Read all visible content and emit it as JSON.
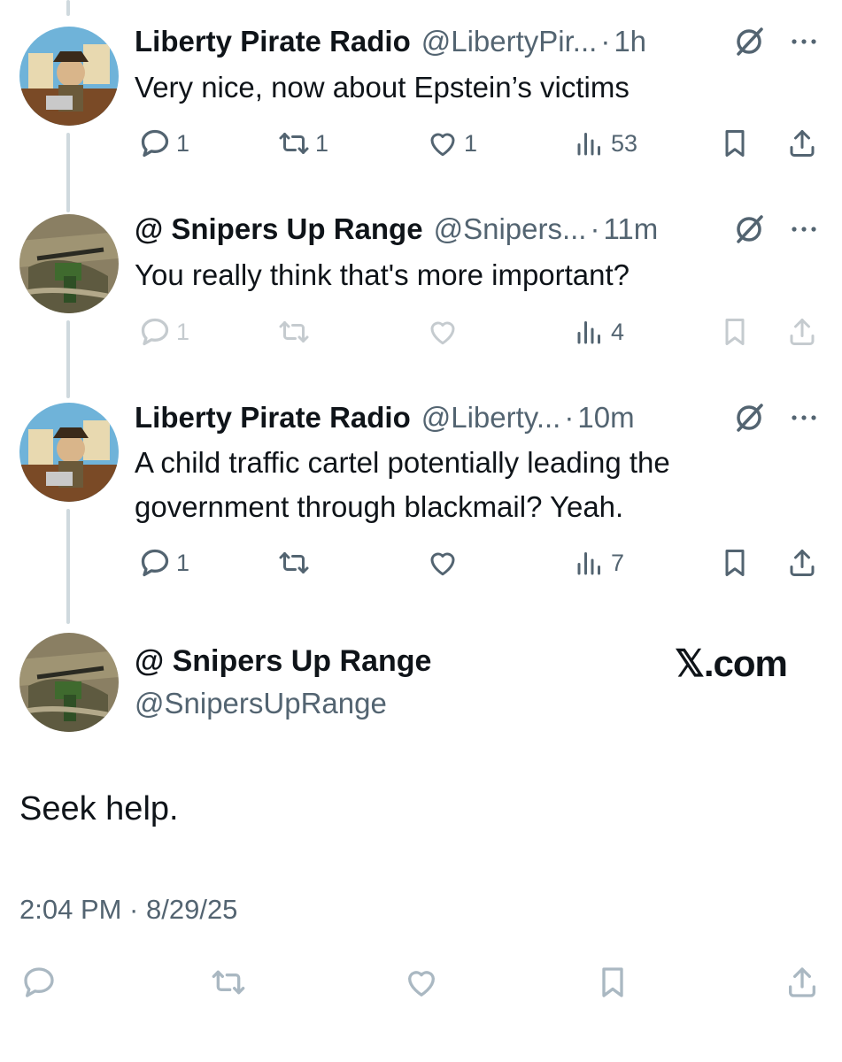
{
  "tweets": [
    {
      "name": "Liberty Pirate Radio",
      "handle": "@LibertyPir...",
      "time": "1h",
      "text": [
        "Very nice, now about Epstein’s victims"
      ],
      "replies": "1",
      "reposts": "1",
      "likes": "1",
      "views": "53",
      "avatar": "pirate-avatar"
    },
    {
      "name": "@ Snipers Up Range",
      "handle": "@Snipers...",
      "time": "11m",
      "text": [
        "You really think that's more important?"
      ],
      "replies": "1",
      "reposts": "",
      "likes": "",
      "views": "4",
      "avatar": "sniper-avatar"
    },
    {
      "name": "Liberty Pirate Radio",
      "handle": "@Liberty...",
      "time": "10m",
      "text": [
        "A child traffic cartel potentially leading the",
        "government through blackmail? Yeah."
      ],
      "replies": "1",
      "reposts": "",
      "likes": "",
      "views": "7",
      "avatar": "pirate-avatar"
    }
  ],
  "main": {
    "name": "@ Snipers Up Range",
    "handle": "@SnipersUpRange",
    "watermark": "𝕏.com",
    "text": "Seek help.",
    "timestamp": "2:04 PM · 8/29/25"
  },
  "separator": "·",
  "colors": {
    "text": "#0f1419",
    "secondary": "#536471",
    "line": "#cfd9de"
  }
}
